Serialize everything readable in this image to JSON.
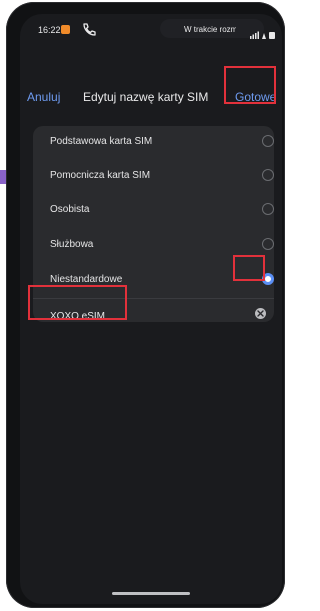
{
  "status_bar": {
    "time": "16:22",
    "text": "W trakcie rozm"
  },
  "header": {
    "cancel_label": "Anuluj",
    "title": "Edytuj nazwę karty SIM",
    "done_label": "Gotowe"
  },
  "options": [
    {
      "label": "Podstawowa karta SIM",
      "selected": false
    },
    {
      "label": "Pomocnicza karta SIM",
      "selected": false
    },
    {
      "label": "Osobista",
      "selected": false
    },
    {
      "label": "Służbowa",
      "selected": false
    },
    {
      "label": "Niestandardowe",
      "selected": true
    }
  ],
  "custom_name": {
    "value": "XOXO eSIM",
    "placeholder": ""
  },
  "colors": {
    "accent": "#6e9bf0",
    "radio_selected": "#5b8ff5",
    "highlight": "#e2313b",
    "background": "#1a1b1e",
    "card": "#2a2b2e"
  }
}
